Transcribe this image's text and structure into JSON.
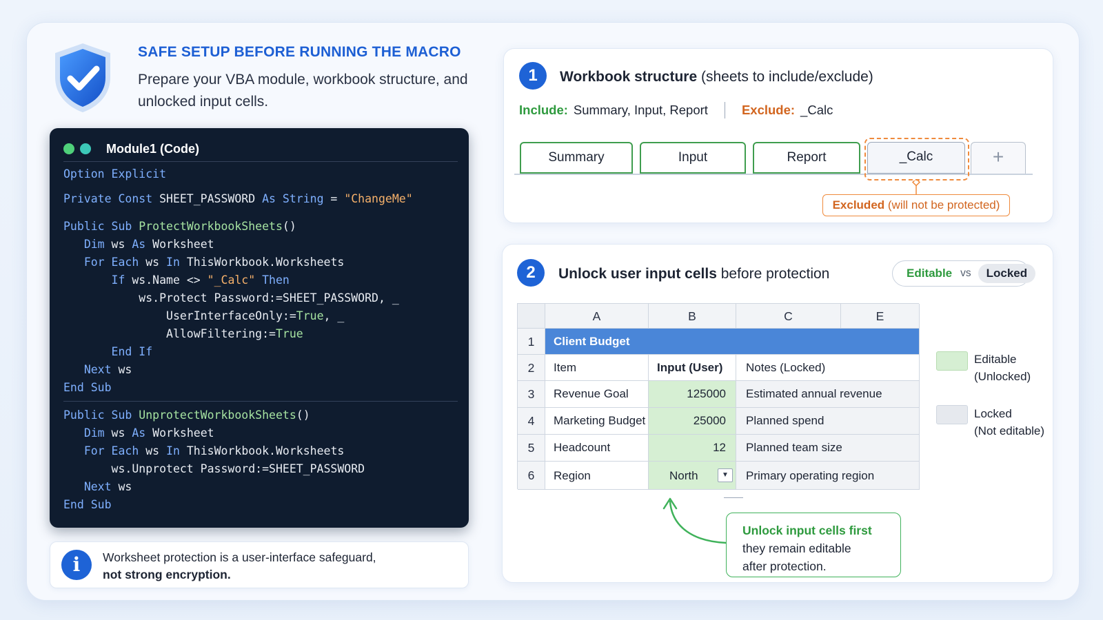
{
  "header": {
    "title": "SAFE SETUP BEFORE RUNNING THE MACRO",
    "subtitle": "Prepare your VBA module, workbook structure, and unlocked input cells.",
    "icon": "shield-check-icon"
  },
  "code_panel": {
    "title": "Module1 (Code)",
    "lines": [
      "Option Explicit",
      "Private Const SHEET_PASSWORD As String = \"ChangeMe\"",
      "Public Sub ProtectWorkbookSheets()",
      "Dim ws As Worksheet",
      "For Each ws In ThisWorkbook.Worksheets",
      "If ws.Name <> \"_Calc\" Then",
      "ws.Protect Password:=SHEET_PASSWORD, _",
      "UserInterfaceOnly:=True, _",
      "AllowFiltering:=True",
      "End If",
      "Next ws",
      "End Sub",
      "Public Sub UnprotectWorkbookSheets()",
      "Dim ws As Worksheet",
      "For Each ws In ThisWorkbook.Worksheets",
      "ws.Unprotect Password:=SHEET_PASSWORD",
      "Next ws",
      "End Sub"
    ]
  },
  "info_note": {
    "text_line1": "Worksheet protection is a user-interface safeguard,",
    "text_bold": "not strong encryption.",
    "icon": "info-icon"
  },
  "section1": {
    "number": "1",
    "title_bold": "Workbook structure",
    "title_rest": " (sheets to include/exclude)",
    "include_label": "Include:",
    "include_value": "Summary, Input, Report",
    "exclude_label": "Exclude:",
    "exclude_value": "_Calc",
    "tabs": [
      "Summary",
      "Input",
      "Report",
      "_Calc"
    ],
    "add_tab": "+",
    "excluded_note_bold": "Excluded",
    "excluded_note_rest": " (will not be protected)"
  },
  "section2": {
    "number": "2",
    "title_bold": "Unlock user input cells",
    "title_rest": " before protection",
    "toggle": {
      "editable": "Editable",
      "vs": "vs",
      "locked": "Locked"
    },
    "grid": {
      "col_headers": [
        "A",
        "B",
        "C",
        "E"
      ],
      "row_numbers": [
        "1",
        "2",
        "3",
        "4",
        "5",
        "6"
      ],
      "title": "Client Budget",
      "header_row": [
        "Item",
        "Input (User)",
        "Notes (Locked)"
      ],
      "rows": [
        [
          "Revenue Goal",
          "125000",
          "Estimated annual revenue"
        ],
        [
          "Marketing Budget",
          "25000",
          "Planned spend"
        ],
        [
          "Headcount",
          "12",
          "Planned team size"
        ],
        [
          "Region",
          "North",
          "Primary operating region"
        ]
      ]
    },
    "legend": {
      "editable_line1": "Editable",
      "editable_line2": "(Unlocked)",
      "locked_line1": "Locked",
      "locked_line2": "(Not editable)"
    },
    "callout": {
      "bold": "Unlock input cells first",
      "line2": "they remain editable",
      "line3": "after protection."
    }
  },
  "colors": {
    "accent_blue": "#1e63d6",
    "include_green": "#2e9a3e",
    "exclude_orange": "#d2651f",
    "editable_fill": "#d6efd3",
    "locked_fill": "#f1f3f6",
    "grid_title_fill": "#4a86d8"
  }
}
